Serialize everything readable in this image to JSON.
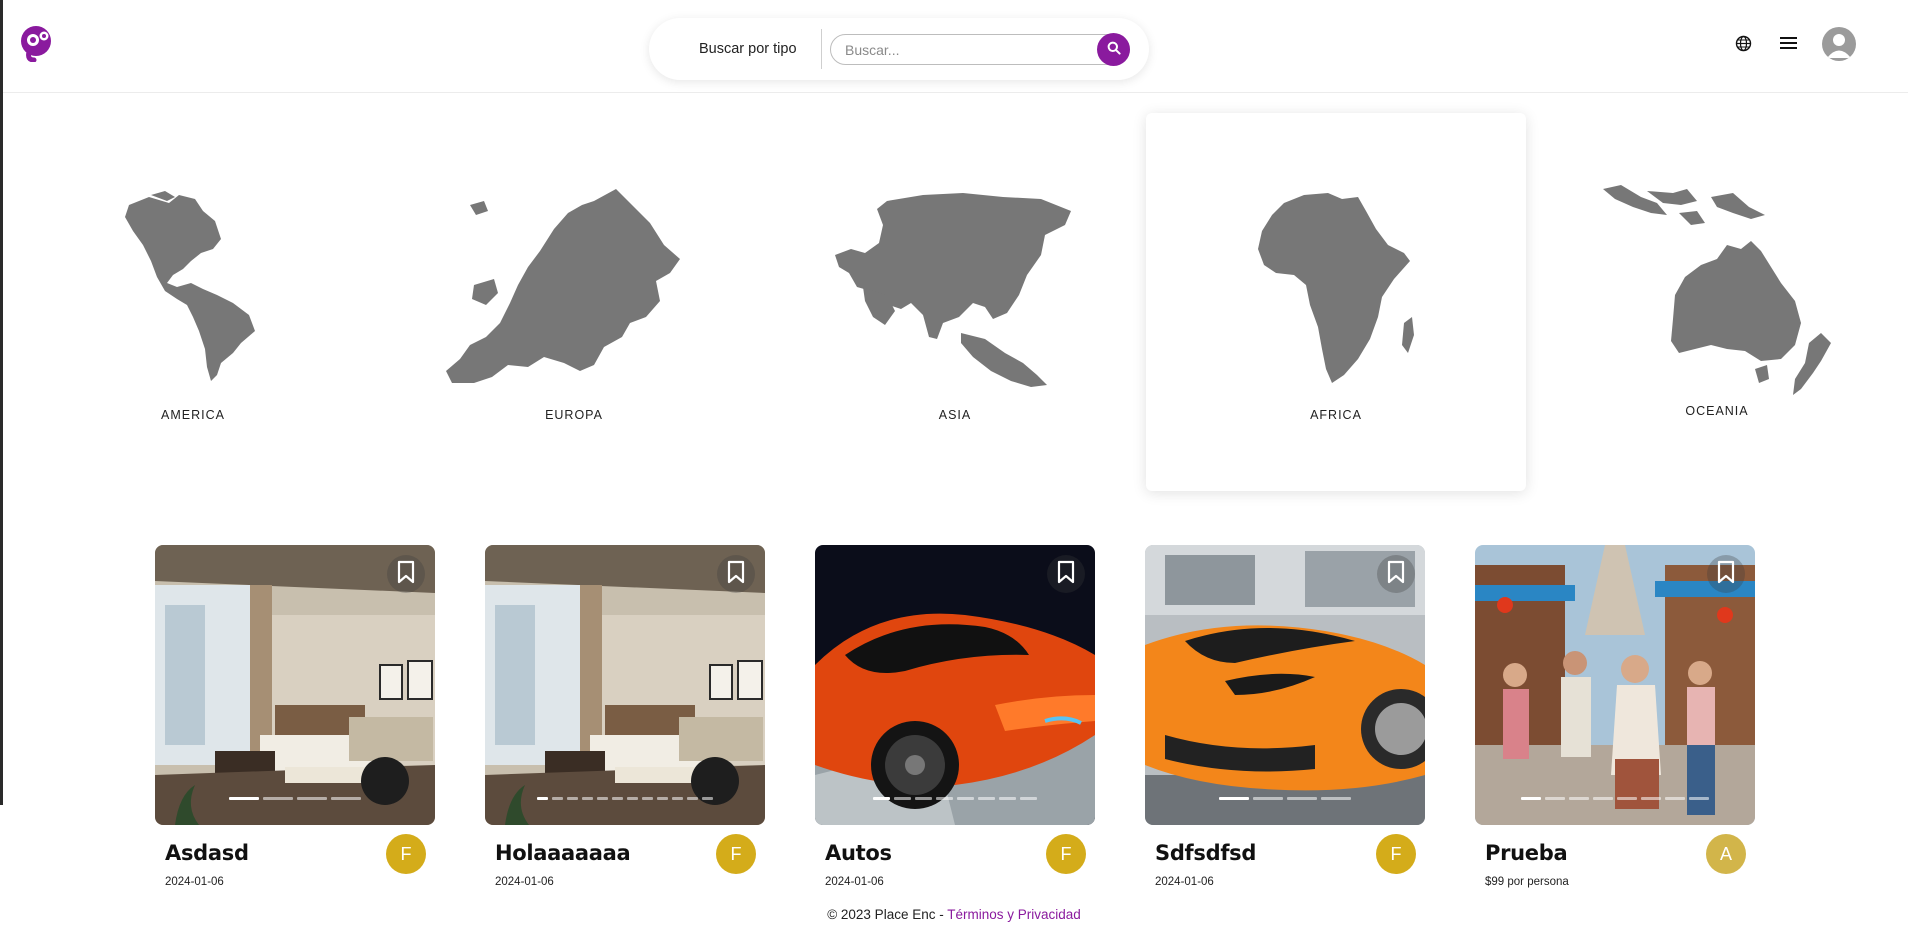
{
  "header": {
    "search_type_label": "Buscar por tipo",
    "search_placeholder": "Buscar...",
    "accent_color": "#8a1a9e"
  },
  "continents": [
    {
      "label": "AMERICA",
      "selected": false
    },
    {
      "label": "EUROPA",
      "selected": false
    },
    {
      "label": "ASIA",
      "selected": false
    },
    {
      "label": "AFRICA",
      "selected": true
    },
    {
      "label": "OCEANIA",
      "selected": false
    }
  ],
  "cards": [
    {
      "title": "Asdasd",
      "subtitle": "2024-01-06",
      "badge": "F",
      "image": "hotel-room",
      "dots": 4,
      "active_dot": 0
    },
    {
      "title": "Holaaaaaaa",
      "subtitle": "2024-01-06",
      "badge": "F",
      "image": "hotel-room",
      "dots": 12,
      "active_dot": 0
    },
    {
      "title": "Autos",
      "subtitle": "2024-01-06",
      "badge": "F",
      "image": "red-sports-car",
      "dots": 8,
      "active_dot": 0
    },
    {
      "title": "Sdfsdfsd",
      "subtitle": "2024-01-06",
      "badge": "F",
      "image": "orange-sports-car",
      "dots": 4,
      "active_dot": 0
    },
    {
      "title": "Prueba",
      "subtitle": "$99 por persona",
      "badge": "A",
      "image": "travelers-street",
      "dots": 8,
      "active_dot": 0
    }
  ],
  "footer": {
    "copyright": "© 2023 Place Enc - ",
    "link": "Términos y Privacidad"
  },
  "colors": {
    "badge": "#d4ac1a",
    "map_fill": "#777777",
    "accent": "#8a1a9e"
  }
}
